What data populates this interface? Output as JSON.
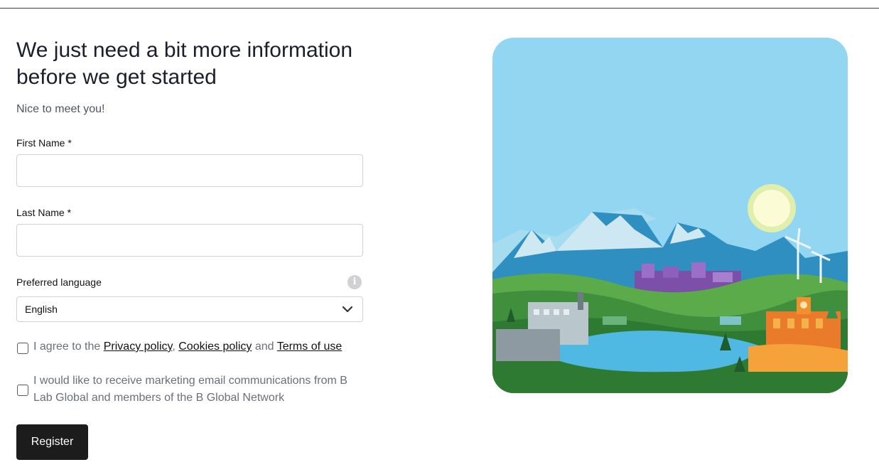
{
  "form": {
    "heading": "We just need a bit more information before we get started",
    "subtitle": "Nice to meet you!",
    "first_name_label": "First Name *",
    "first_name_value": "",
    "last_name_label": "Last Name *",
    "last_name_value": "",
    "language_label": "Preferred language",
    "language_value": "English",
    "agree_prefix": "I agree to the ",
    "privacy_link": "Privacy policy",
    "sep1": ", ",
    "cookies_link": "Cookies policy",
    "sep2": " and ",
    "terms_link": "Terms of use",
    "agree_checked": false,
    "marketing_text": "I would like to receive marketing email communications from B Lab Global and members of the B Global Network",
    "marketing_checked": false,
    "register_label": "Register"
  },
  "icons": {
    "info": "info-icon",
    "chevron": "chevron-down-icon"
  },
  "colors": {
    "button_bg": "#1c1c1c",
    "sky": "#8fd4f0",
    "info_icon": "#cfd1d4"
  }
}
